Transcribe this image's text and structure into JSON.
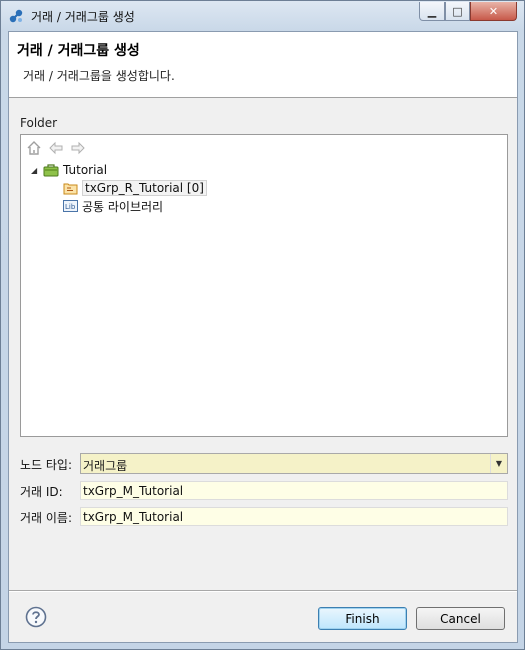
{
  "window": {
    "title": "거래 / 거래그룹 생성"
  },
  "header": {
    "title": "거래 / 거래그룹 생성",
    "description": "거래 / 거래그룹을 생성합니다."
  },
  "folder": {
    "label": "Folder",
    "tree": {
      "root": {
        "label": "Tutorial"
      },
      "children": [
        {
          "label": "txGrp_R_Tutorial [0]",
          "selected": true,
          "icon": "tx-group-icon"
        },
        {
          "label": "공통 라이브러리",
          "icon": "library-icon",
          "icon_text": "Lib"
        }
      ]
    }
  },
  "form": {
    "node_type": {
      "label": "노드 타입:",
      "value": "거래그룹"
    },
    "tx_id": {
      "label": "거래 ID:",
      "value": "txGrp_M_Tutorial"
    },
    "tx_name": {
      "label": "거래 이름:",
      "value": "txGrp_M_Tutorial"
    }
  },
  "buttons": {
    "finish": "Finish",
    "cancel": "Cancel"
  },
  "colors": {
    "input_background": "#fefee6",
    "combo_background": "#f5f2c8",
    "default_button_border": "#3c7fb1"
  }
}
